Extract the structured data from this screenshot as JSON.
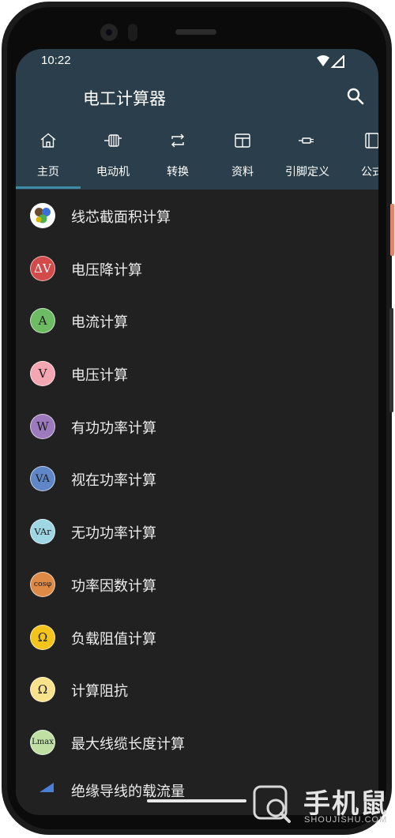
{
  "status_bar": {
    "time": "10:22"
  },
  "app_bar": {
    "title": "电工计算器"
  },
  "tabs": [
    {
      "label": "主页",
      "icon": "home-icon",
      "selected": true
    },
    {
      "label": "电动机",
      "icon": "motor-icon"
    },
    {
      "label": "转换",
      "icon": "convert-icon"
    },
    {
      "label": "资料",
      "icon": "table-icon"
    },
    {
      "label": "引脚定义",
      "icon": "connector-icon"
    },
    {
      "label": "公式",
      "icon": "book-icon"
    }
  ],
  "list": [
    {
      "label": "线芯截面积计算",
      "icon_text": "",
      "icon_color": "#ffffff"
    },
    {
      "label": "电压降计算",
      "icon_text": "ΔV",
      "icon_color": "#d24a4a"
    },
    {
      "label": "电流计算",
      "icon_text": "A",
      "icon_color": "#6dbb62"
    },
    {
      "label": "电压计算",
      "icon_text": "V",
      "icon_color": "#f4a7b2"
    },
    {
      "label": "有功功率计算",
      "icon_text": "W",
      "icon_color": "#9c7abd"
    },
    {
      "label": "视在功率计算",
      "icon_text": "VA",
      "icon_color": "#5f86c7"
    },
    {
      "label": "无功功率计算",
      "icon_text": "VAr",
      "icon_color": "#9fd6e3"
    },
    {
      "label": "功率因数计算",
      "icon_text": "cosφ",
      "icon_color": "#e08a47"
    },
    {
      "label": "负载阻值计算",
      "icon_text": "Ω",
      "icon_color": "#f3c51c"
    },
    {
      "label": "计算阻抗",
      "icon_text": "Ω",
      "icon_color": "#f9e28c"
    },
    {
      "label": "最大线缆长度计算",
      "icon_text": "Lmax",
      "icon_color": "#bfe0a2"
    },
    {
      "label": "绝缘导线的载流量",
      "icon_text": "",
      "icon_color": "#4a7fd6"
    }
  ],
  "watermark": {
    "text": "手机鼠",
    "subtext": "SHOUJISHU.COM"
  },
  "colors": {
    "header": "#2a3f4b",
    "indicator": "#3f8ba6",
    "background": "#212121"
  }
}
